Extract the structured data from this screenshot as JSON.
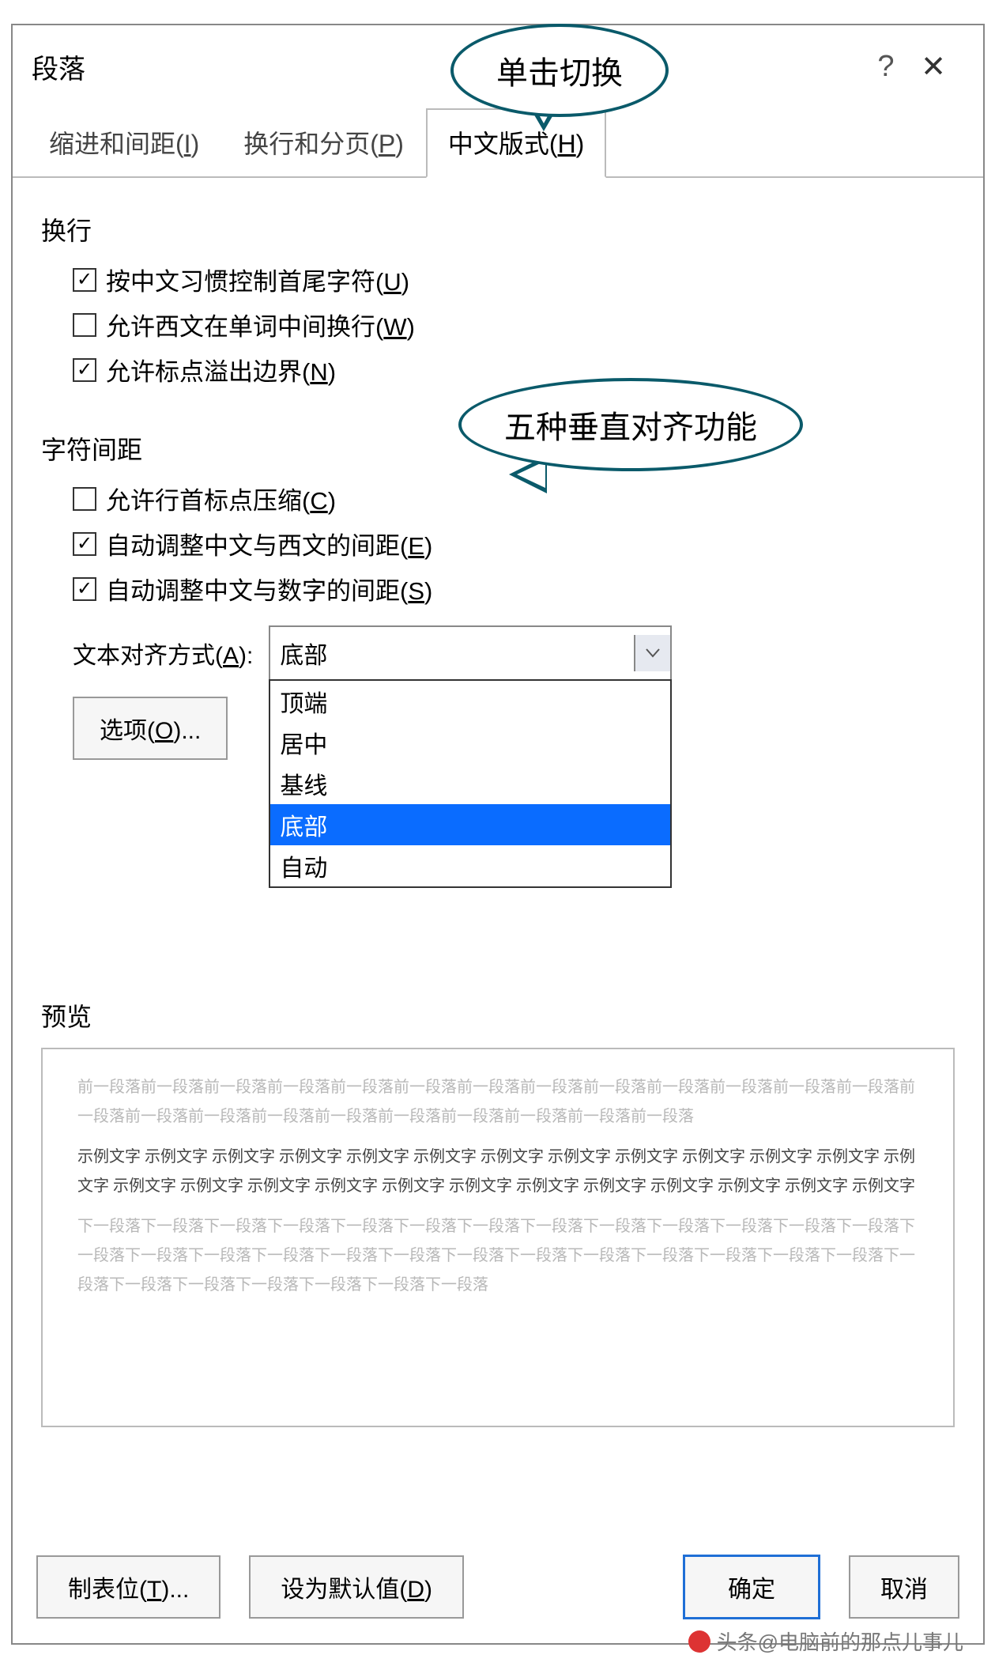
{
  "callouts": {
    "top": "单击切换",
    "middle": "五种垂直对齐功能"
  },
  "dialog": {
    "title": "段落",
    "tabs": [
      {
        "label_pre": "缩进和间距(",
        "key": "I",
        "label_post": ")",
        "active": false
      },
      {
        "label_pre": "换行和分页(",
        "key": "P",
        "label_post": ")",
        "active": false
      },
      {
        "label_pre": "中文版式(",
        "key": "H",
        "label_post": ")",
        "active": true
      }
    ],
    "section1_title": "换行",
    "checks1": [
      {
        "checked": true,
        "pre": "按中文习惯控制首尾字符(",
        "key": "U",
        "post": ")"
      },
      {
        "checked": false,
        "pre": "允许西文在单词中间换行(",
        "key": "W",
        "post": ")"
      },
      {
        "checked": true,
        "pre": "允许标点溢出边界(",
        "key": "N",
        "post": ")"
      }
    ],
    "section2_title": "字符间距",
    "checks2": [
      {
        "checked": false,
        "pre": "允许行首标点压缩(",
        "key": "C",
        "post": ")"
      },
      {
        "checked": true,
        "pre": "自动调整中文与西文的间距(",
        "key": "E",
        "post": ")"
      },
      {
        "checked": true,
        "pre": "自动调整中文与数字的间距(",
        "key": "S",
        "post": ")"
      }
    ],
    "align_label_pre": "文本对齐方式(",
    "align_label_key": "A",
    "align_label_post": "):",
    "align_selected": "底部",
    "align_options": [
      "顶端",
      "居中",
      "基线",
      "底部",
      "自动"
    ],
    "options_btn_pre": "选项(",
    "options_btn_key": "O",
    "options_btn_post": ")...",
    "preview_title": "预览",
    "preview_prev": "前一段落前一段落前一段落前一段落前一段落前一段落前一段落前一段落前一段落前一段落前一段落前一段落前一段落前一段落前一段落前一段落前一段落前一段落前一段落前一段落前一段落前一段落前一段落",
    "preview_sample": "示例文字 示例文字 示例文字 示例文字 示例文字 示例文字 示例文字 示例文字 示例文字 示例文字 示例文字 示例文字 示例文字 示例文字 示例文字 示例文字 示例文字 示例文字 示例文字 示例文字 示例文字 示例文字 示例文字 示例文字 示例文字",
    "preview_next": "下一段落下一段落下一段落下一段落下一段落下一段落下一段落下一段落下一段落下一段落下一段落下一段落下一段落下一段落下一段落下一段落下一段落下一段落下一段落下一段落下一段落下一段落下一段落下一段落下一段落下一段落下一段落下一段落下一段落下一段落下一段落下一段落下一段落",
    "footer": {
      "tabstops_pre": "制表位(",
      "tabstops_key": "T",
      "tabstops_post": ")...",
      "default_pre": "设为默认值(",
      "default_key": "D",
      "default_post": ")",
      "ok": "确定",
      "cancel": "取消"
    }
  },
  "watermark": "头条@电脑前的那点儿事儿"
}
